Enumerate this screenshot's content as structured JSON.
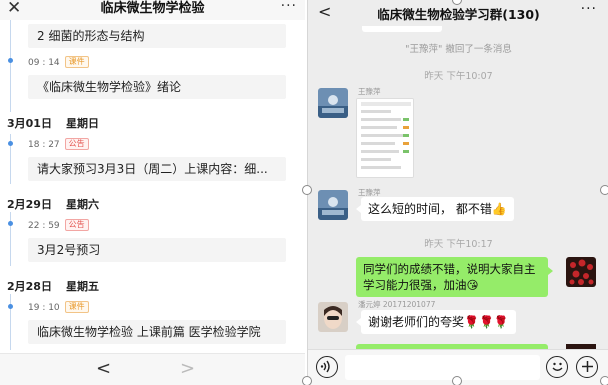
{
  "left": {
    "header": {
      "close_icon": "✕",
      "title": "临床微生物学检验",
      "more_icon": "···"
    },
    "entries": [
      {
        "type": "card",
        "text": "2 细菌的形态与结构"
      },
      {
        "type": "meta",
        "time": "09 : 14",
        "tag": "课件",
        "tag_kind": "assign"
      },
      {
        "type": "card",
        "text": "《临床微生物学检验》绪论"
      },
      {
        "type": "date",
        "date": "3月01日",
        "weekday": "星期日"
      },
      {
        "type": "meta",
        "time": "18 : 27",
        "tag": "公告",
        "tag_kind": "notice"
      },
      {
        "type": "card",
        "text": "请大家预习3月3日（周二）上课内容：细..."
      },
      {
        "type": "date",
        "date": "2月29日",
        "weekday": "星期六"
      },
      {
        "type": "meta",
        "time": "22 : 59",
        "tag": "公告",
        "tag_kind": "notice"
      },
      {
        "type": "card",
        "text": "3月2号预习"
      },
      {
        "type": "date",
        "date": "2月28日",
        "weekday": "星期五"
      },
      {
        "type": "meta",
        "time": "19 : 10",
        "tag": "课件",
        "tag_kind": "assign"
      },
      {
        "type": "card",
        "text": "临床微生物学检验 上课前篇 医学检验学院"
      }
    ],
    "footer": {
      "prev": "<",
      "next": ">"
    }
  },
  "right": {
    "header": {
      "back": "<",
      "title": "临床微生物检验学习群(130)",
      "more": "···"
    },
    "system_message": "\"王豫萍\" 撤回了一条消息",
    "timestamp1": "昨天 下午10:07",
    "timestamp2": "昨天 下午10:17",
    "messages": [
      {
        "sender": "王豫萍",
        "kind": "image"
      },
      {
        "sender": "王豫萍",
        "text": "这么短的时间， 都不错👍"
      },
      {
        "self": true,
        "text": "同学们的成绩不错，说明大家自主学习能力很强，加油😘"
      },
      {
        "sender": "潘元婷 20171201077",
        "text": "谢谢老师们的夸奖🌹🌹🌹"
      }
    ],
    "footer": {
      "voice_icon": "voice-icon",
      "emoji_icon": "emoji-icon",
      "plus_icon": "plus-icon"
    }
  },
  "colors": {
    "wechat_green": "#95ec69",
    "tag_orange": "#e89b2f",
    "tag_red": "#e3534f",
    "timeline_blue": "#4a90e2"
  }
}
